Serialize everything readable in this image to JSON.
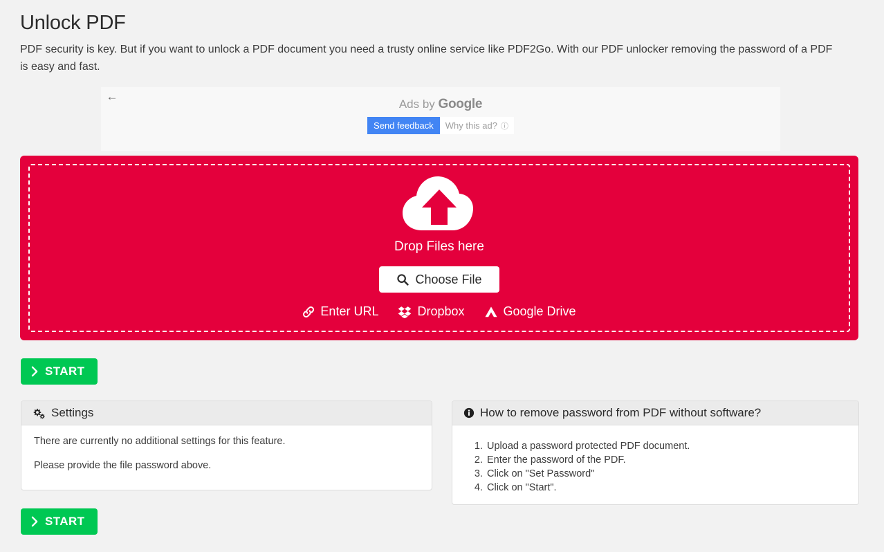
{
  "header": {
    "title": "Unlock PDF",
    "description": "PDF security is key. But if you want to unlock a PDF document you need a trusty online service like PDF2Go. With our PDF unlocker removing the password of a PDF is easy and fast."
  },
  "ad": {
    "back_arrow": "←",
    "ads_by_prefix": "Ads by ",
    "ads_by_brand": "Google",
    "send_feedback_label": "Send feedback",
    "why_this_ad_label": "Why this ad?",
    "why_this_ad_info_icon": "ⓘ"
  },
  "dropzone": {
    "drop_label": "Drop Files here",
    "choose_file_label": "Choose File",
    "background_color": "#e4003c",
    "sources": [
      {
        "label": "Enter URL",
        "icon": "link-icon"
      },
      {
        "label": "Dropbox",
        "icon": "dropbox-icon"
      },
      {
        "label": "Google Drive",
        "icon": "google-drive-icon"
      }
    ]
  },
  "actions": {
    "start_top_label": "START",
    "start_bottom_label": "START",
    "start_color": "#00c853"
  },
  "settings_panel": {
    "title": "Settings",
    "icon": "cogs-icon",
    "line1": "There are currently no additional settings for this feature.",
    "line2": "Please provide the file password above."
  },
  "howto_panel": {
    "title": "How to remove password from PDF without software?",
    "icon": "info-circle-icon",
    "steps": [
      "Upload a password protected PDF document.",
      "Enter the password of the PDF.",
      "Click on \"Set Password\"",
      "Click on \"Start\"."
    ]
  }
}
